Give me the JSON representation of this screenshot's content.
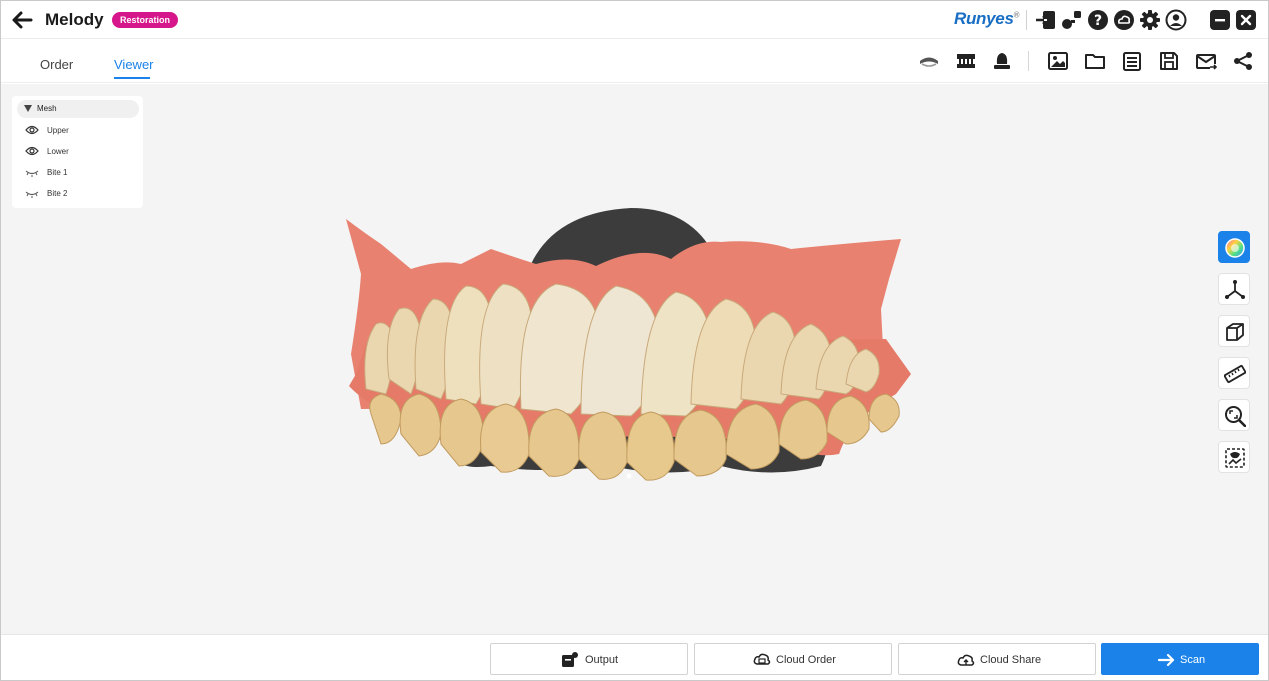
{
  "titlebar": {
    "patient_name": "Melody",
    "case_type_badge": "Restoration",
    "brand": "Runyes",
    "brand_mark": "®",
    "icons": [
      "import-icon",
      "node-icon",
      "help-icon",
      "cloud-icon",
      "settings-icon",
      "account-icon"
    ],
    "window_controls": [
      "minimize-icon",
      "close-icon"
    ]
  },
  "tabs": [
    {
      "label": "Order",
      "active": false
    },
    {
      "label": "Viewer",
      "active": true
    }
  ],
  "toolbar": {
    "view_icons": [
      "upper-jaw-view-icon",
      "lower-jaw-view-icon",
      "tooth-view-icon"
    ],
    "file_icons": [
      "screenshot-icon",
      "folder-icon",
      "notes-icon",
      "save-icon",
      "email-icon",
      "share-icon"
    ]
  },
  "mesh_panel": {
    "header": "Mesh",
    "items": [
      {
        "label": "Upper",
        "icon": "eye-icon"
      },
      {
        "label": "Lower",
        "icon": "eye-icon"
      },
      {
        "label": "Bite 1",
        "icon": "eye-closed-icon"
      },
      {
        "label": "Bite 2",
        "icon": "eye-closed-icon"
      }
    ]
  },
  "side_tools": [
    "color-toggle-icon",
    "axis-icon",
    "cube-view-icon",
    "ruler-icon",
    "zoom-icon",
    "selection-icon"
  ],
  "bottom_bar": {
    "output_label": "Output",
    "cloud_order_label": "Cloud Order",
    "cloud_share_label": "Cloud Share",
    "scan_label": "Scan"
  },
  "colors": {
    "accent": "#1a82e8",
    "badge": "#d6168b",
    "brand": "#1a6fc4",
    "gum": "#e8816f",
    "tooth": "#ead7b0",
    "scan_base": "#3c3c3c"
  }
}
